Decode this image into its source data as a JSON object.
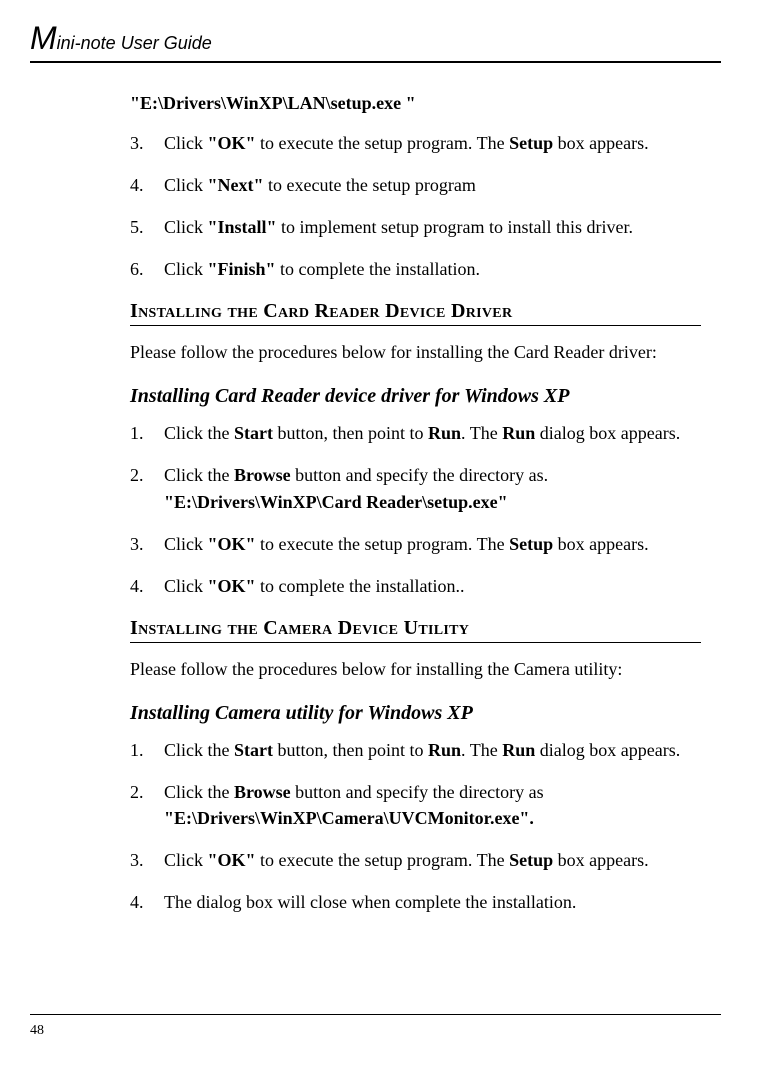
{
  "header": {
    "big": "M",
    "rest": "ini-note User Guide"
  },
  "top_path": "\"E:\\Drivers\\WinXP\\LAN\\setup.exe \"",
  "lan_steps": [
    {
      "n": "3.",
      "pre": "Click ",
      "b1": "\"OK\"",
      "mid": " to execute the setup program. The ",
      "b2": "Setup",
      "post": " box appears."
    },
    {
      "n": "4.",
      "pre": "Click ",
      "b1": "\"Next\"",
      "mid": " to execute the setup program",
      "b2": "",
      "post": ""
    },
    {
      "n": "5.",
      "pre": "Click ",
      "b1": "\"Install\"",
      "mid": " to implement setup program to install this driver.",
      "b2": "",
      "post": ""
    },
    {
      "n": "6.",
      "pre": "Click ",
      "b1": "\"Finish\"",
      "mid": " to complete the installation.",
      "b2": "",
      "post": ""
    }
  ],
  "section1": {
    "heading": "Installing the Card Reader Device Driver",
    "intro": "Please follow the procedures below for installing the Card Reader driver:",
    "subheading": "Installing Card Reader device driver for Windows XP",
    "steps": [
      {
        "n": "1.",
        "html": "Click the <b>Start</b> button, then point to <b>Run</b>. The <b>Run</b> dialog box appears."
      },
      {
        "n": "2.",
        "html": "Click the <b>Browse</b> button and specify the directory as.<br><b>\"E:\\Drivers\\WinXP\\Card Reader\\setup.exe\"</b>"
      },
      {
        "n": "3.",
        "html": "Click <b>\"OK\"</b> to execute the setup program. The <b>Setup</b> box appears."
      },
      {
        "n": "4.",
        "html": "Click <b>\"OK\"</b> to complete the installation.."
      }
    ]
  },
  "section2": {
    "heading": "Installing the Camera Device Utility",
    "intro": "Please follow the procedures below for installing the Camera utility:",
    "subheading": "Installing Camera utility for Windows XP",
    "steps": [
      {
        "n": "1.",
        "html": "Click the <b>Start</b> button, then point to <b>Run</b>. The <b>Run</b> dialog box appears."
      },
      {
        "n": "2.",
        "html": "Click the <b>Browse</b> button and specify the directory as<br><b>\"E:\\Drivers\\WinXP\\Camera\\UVCMonitor.exe\".</b>"
      },
      {
        "n": "3.",
        "html": "Click <b>\"OK\"</b> to execute the setup program. The <b>Setup</b> box appears."
      },
      {
        "n": "4.",
        "html": "The dialog box will close when complete the installation."
      }
    ]
  },
  "page_number": "48"
}
